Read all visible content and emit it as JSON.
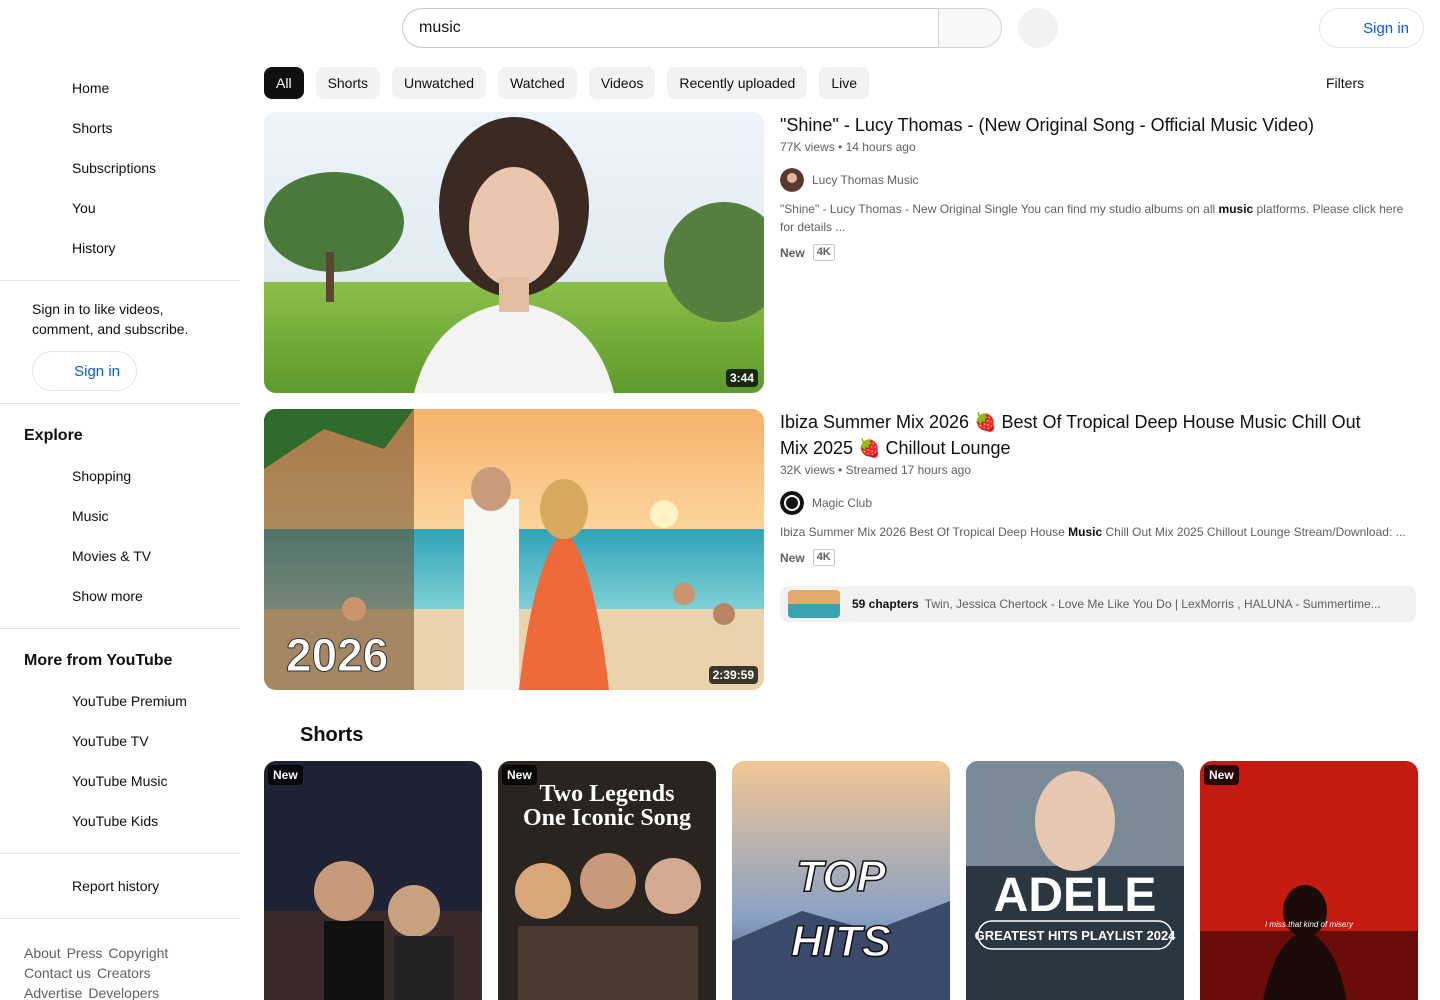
{
  "header": {
    "search_value": "music",
    "signin_label": "Sign in"
  },
  "sidebar": {
    "main": [
      {
        "label": "Home",
        "icon": "home-icon"
      },
      {
        "label": "Shorts",
        "icon": "shorts-icon"
      },
      {
        "label": "Subscriptions",
        "icon": "subscriptions-icon"
      },
      {
        "label": "You",
        "icon": "you-icon"
      },
      {
        "label": "History",
        "icon": "history-icon"
      }
    ],
    "signin_prompt": "Sign in to like videos, comment, and subscribe.",
    "signin_label": "Sign in",
    "explore_heading": "Explore",
    "explore": [
      {
        "label": "Shopping",
        "icon": "shopping-icon"
      },
      {
        "label": "Music",
        "icon": "music-icon"
      },
      {
        "label": "Movies & TV",
        "icon": "movies-icon"
      },
      {
        "label": "Show more",
        "icon": "chevron-down-icon"
      }
    ],
    "more_heading": "More from YouTube",
    "more": [
      {
        "label": "YouTube Premium",
        "icon": "youtube-premium-icon"
      },
      {
        "label": "YouTube TV",
        "icon": "youtube-tv-icon"
      },
      {
        "label": "YouTube Music",
        "icon": "youtube-music-icon"
      },
      {
        "label": "YouTube Kids",
        "icon": "youtube-kids-icon"
      }
    ],
    "report_history": "Report history",
    "footer": {
      "line1": [
        "About",
        "Press",
        "Copyright"
      ],
      "line2": [
        "Contact us",
        "Creators"
      ],
      "line3": [
        "Advertise",
        "Developers"
      ]
    }
  },
  "chips": [
    "All",
    "Shorts",
    "Unwatched",
    "Watched",
    "Videos",
    "Recently uploaded",
    "Live"
  ],
  "filters_label": "Filters",
  "videos": [
    {
      "title": "\"Shine\" - Lucy Thomas - (New Original Song - Official Music Video)",
      "views": "77K views",
      "age": "14 hours ago",
      "channel": "Lucy Thomas Music",
      "snippet_before": "\"Shine\" - Lucy Thomas - New Original Single You can find my studio albums on all ",
      "snippet_bold": "music",
      "snippet_after": " platforms. Please click here for details ...",
      "badge_new": "New",
      "badge_quality": "4K",
      "duration": "3:44"
    },
    {
      "title": "Ibiza Summer Mix 2026 🍓 Best Of Tropical Deep House Music Chill Out Mix 2025 🍓 Chillout Lounge",
      "views": "32K views",
      "age": "Streamed 17 hours ago",
      "channel": "Magic Club",
      "snippet_before": "Ibiza Summer Mix 2026 Best Of Tropical Deep House ",
      "snippet_bold": "Music",
      "snippet_after": " Chill Out Mix 2025 Chillout Lounge Stream/Download: ...",
      "badge_new": "New",
      "badge_quality": "4K",
      "duration": "2:39:59",
      "chapters_count": "59 chapters",
      "chapters_text": "Twin, Jessica Chertock - Love Me Like You Do | LexMorris , HALUNA - Summertime..."
    }
  ],
  "shorts_heading": "Shorts",
  "shorts": [
    {
      "badge": "New"
    },
    {
      "badge": "New"
    },
    {
      "badge": ""
    },
    {
      "badge": ""
    },
    {
      "badge": "New"
    }
  ]
}
